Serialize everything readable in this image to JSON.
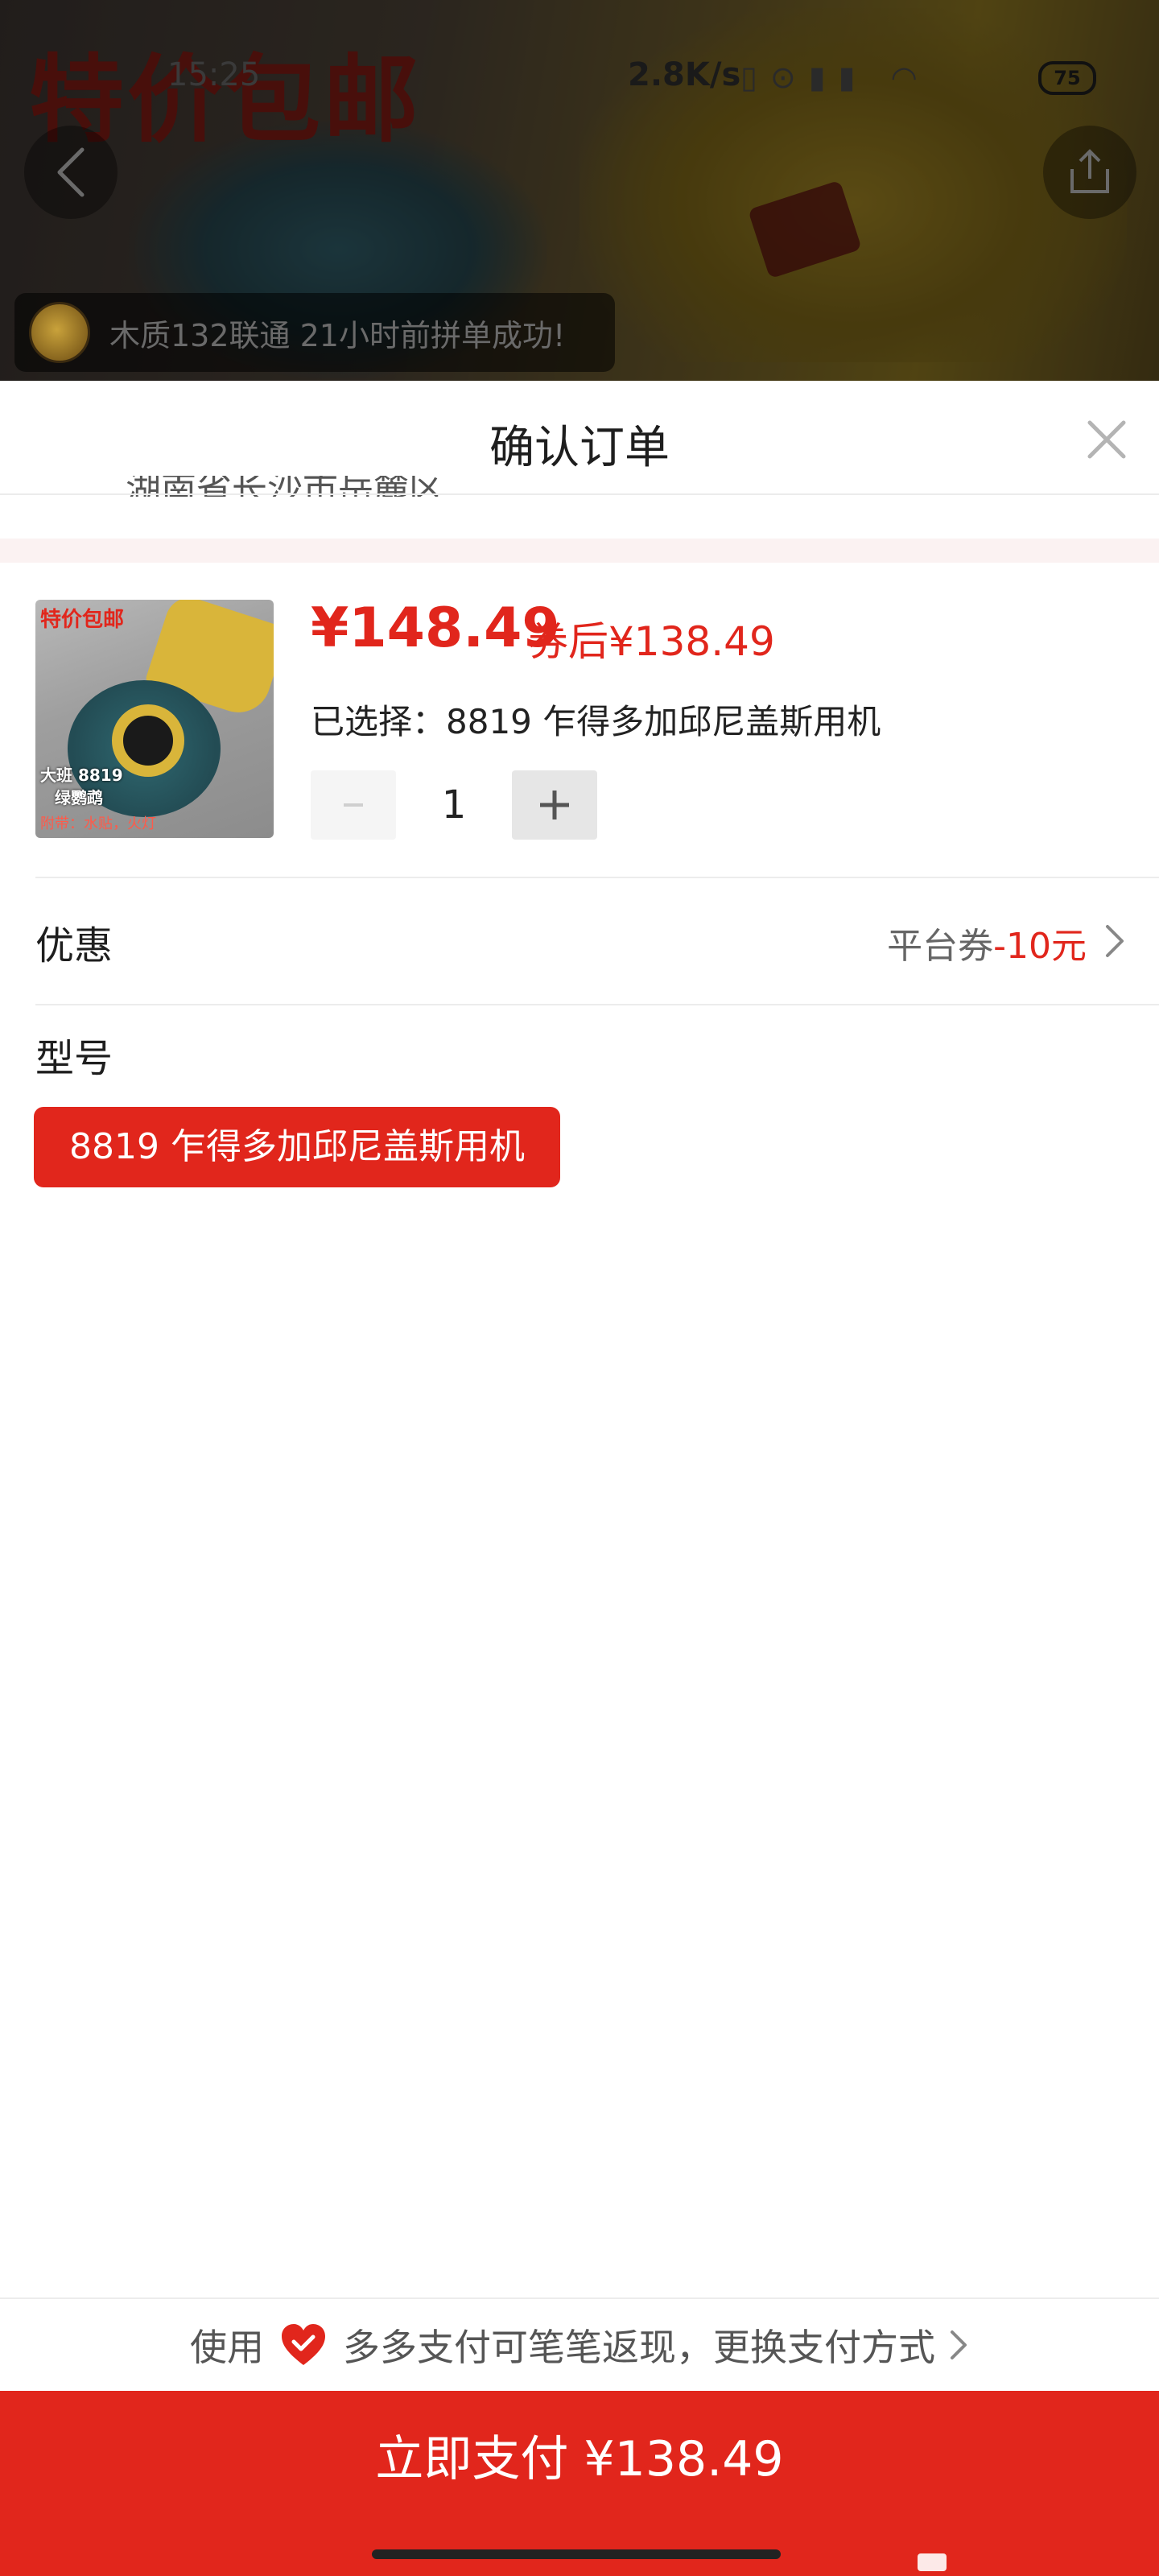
{
  "banner": {
    "slogan": "特价包邮",
    "group_toast": "木质132联通 21小时前拼单成功!"
  },
  "status_bar": {
    "time": "15:25",
    "speed": "2.8K/s",
    "battery": "75"
  },
  "sheet": {
    "title": "确认订单",
    "clipped_address": "湖南省长沙市岳麓区"
  },
  "product": {
    "thumb_badge": "特价包邮",
    "thumb_model_line1": "大班 8819",
    "thumb_model_line2": "绿鹦鹉",
    "thumb_accessories": "附带：水贴，火灯",
    "price": "¥148.49",
    "coupon_price": "券后¥138.49",
    "selected_label": "已选择：",
    "selected_value": "8819 乍得多加邱尼盖斯用机",
    "quantity": "1"
  },
  "discount": {
    "label": "优惠",
    "value_prefix": "平台券",
    "value_amount": "-10元"
  },
  "model": {
    "label": "型号",
    "options": [
      "8819 乍得多加邱尼盖斯用机"
    ],
    "selected_index": 0
  },
  "payment": {
    "hint_prefix": "使用",
    "hint_text": "多多支付可笔笔返现，更换支付方式",
    "pay_button_label": "立即支付 ¥138.49"
  },
  "colors": {
    "accent": "#e1261c",
    "text_primary": "#1e1e1e",
    "text_secondary": "#666666",
    "divider": "#ececec"
  },
  "icons": [
    "back-icon",
    "share-icon",
    "close-icon",
    "minus-icon",
    "plus-icon",
    "chevron-right-icon",
    "heart-check-icon"
  ]
}
